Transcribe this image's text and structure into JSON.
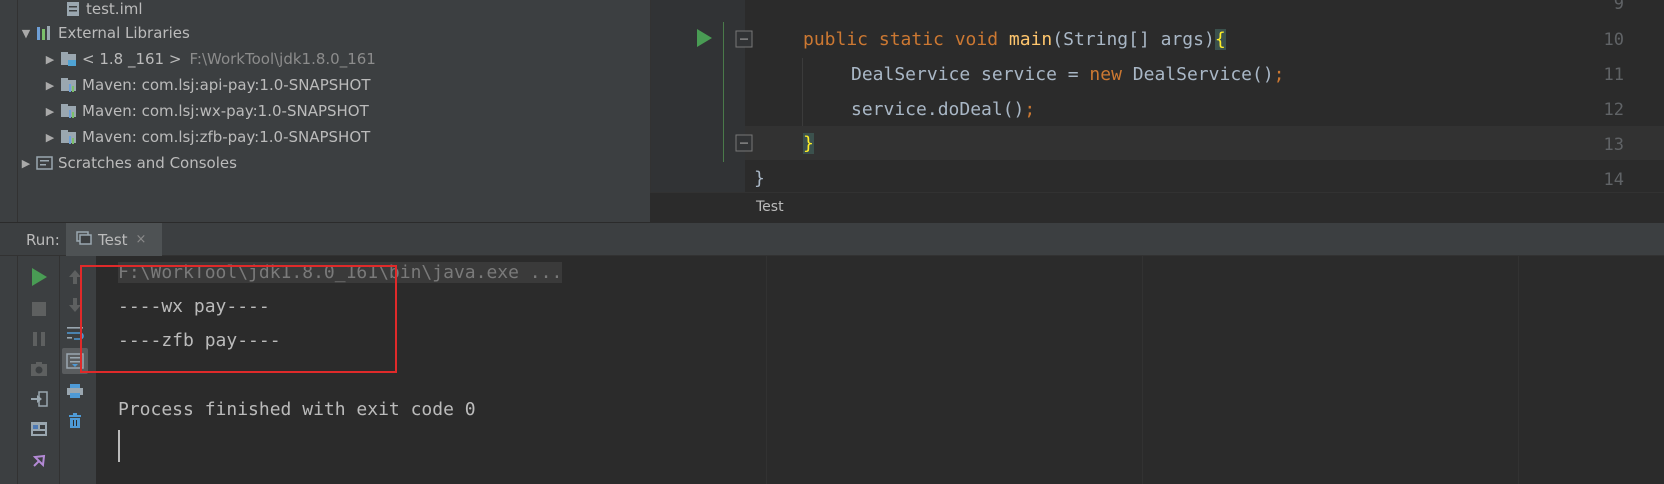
{
  "project_tree": {
    "items": [
      {
        "label": "test.iml",
        "icon": "file-icon",
        "arrow": ""
      },
      {
        "label": "External Libraries",
        "icon": "library-icon",
        "arrow": "▼"
      },
      {
        "label": "< 1.8 _161 >",
        "extra": "F:\\WorkTool\\jdk1.8.0_161",
        "icon": "jdk-icon",
        "arrow": "▶"
      },
      {
        "label": "Maven: com.lsj:api-pay:1.0-SNAPSHOT",
        "icon": "maven-library-icon",
        "arrow": "▶"
      },
      {
        "label": "Maven: com.lsj:wx-pay:1.0-SNAPSHOT",
        "icon": "maven-library-icon",
        "arrow": "▶"
      },
      {
        "label": "Maven: com.lsj:zfb-pay:1.0-SNAPSHOT",
        "icon": "maven-library-icon",
        "arrow": "▶"
      },
      {
        "label": "Scratches and Consoles",
        "icon": "scratches-icon",
        "arrow": "▶"
      }
    ]
  },
  "editor": {
    "line_numbers": [
      "9",
      "10",
      "11",
      "12",
      "13",
      "14"
    ],
    "lines": {
      "l10_kw": "public static void ",
      "l10_fn": "main",
      "l10_rest": "(String[] args)",
      "l10_brace": "{",
      "l11_a": "DealService service = ",
      "l11_kw": "new ",
      "l11_b": "DealService()",
      "l11_semi": ";",
      "l12_a": "service.doDeal()",
      "l12_semi": ";",
      "l13_brace": "}",
      "l14_brace": "}"
    },
    "breadcrumb": "Test"
  },
  "run_window": {
    "label": "Run:",
    "tab_label": "Test",
    "tab_close": "×",
    "console_lines": {
      "command": "F:\\WorkTool\\jdk1.8.0_161\\bin\\java.exe ...",
      "out1": "----wx pay----",
      "out2": "----zfb pay----",
      "exit": "Process finished with exit code 0"
    }
  },
  "colors": {
    "highlight_box": "#e02a2a",
    "run_green": "#499c54",
    "keyword": "#cc7832",
    "function": "#ffc66d"
  }
}
